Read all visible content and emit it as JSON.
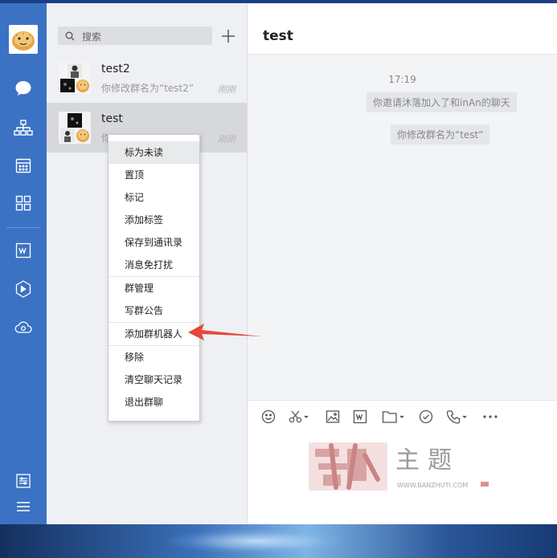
{
  "nav": {
    "items": [
      "chat-icon",
      "org-icon",
      "calendar-icon",
      "apps-icon",
      "document-icon",
      "cube-icon",
      "cloud-icon"
    ],
    "bottom": [
      "settings-icon",
      "menu-icon"
    ]
  },
  "search": {
    "placeholder": "搜索"
  },
  "conversations": [
    {
      "name": "test2",
      "preview": "你修改群名为“test2”",
      "time": "刚刚"
    },
    {
      "name": "test",
      "preview": "你",
      "time": "刚刚"
    }
  ],
  "chat": {
    "title": "test",
    "timestamp": "17:19",
    "messages": [
      "你邀请沐落加入了和inAn的聊天",
      "你修改群名为“test”"
    ]
  },
  "context_menu": {
    "items": [
      "标为未读",
      "置顶",
      "标记",
      "添加标签",
      "保存到通讯录",
      "消息免打扰",
      "群管理",
      "写群公告",
      "添加群机器人",
      "移除",
      "清空聊天记录",
      "退出群聊"
    ]
  },
  "toolbar": [
    "emoji-icon",
    "scissors-icon",
    "image-icon",
    "word-icon",
    "folder-icon",
    "check-icon",
    "phone-icon",
    "more-icon"
  ],
  "watermark": {
    "main": "主题",
    "url": "WWW.BANZHUTI.COM"
  },
  "colors": {
    "rail": "#3c72c4",
    "menu_hover": "#e9eaec",
    "arrow": "#e8463a"
  }
}
